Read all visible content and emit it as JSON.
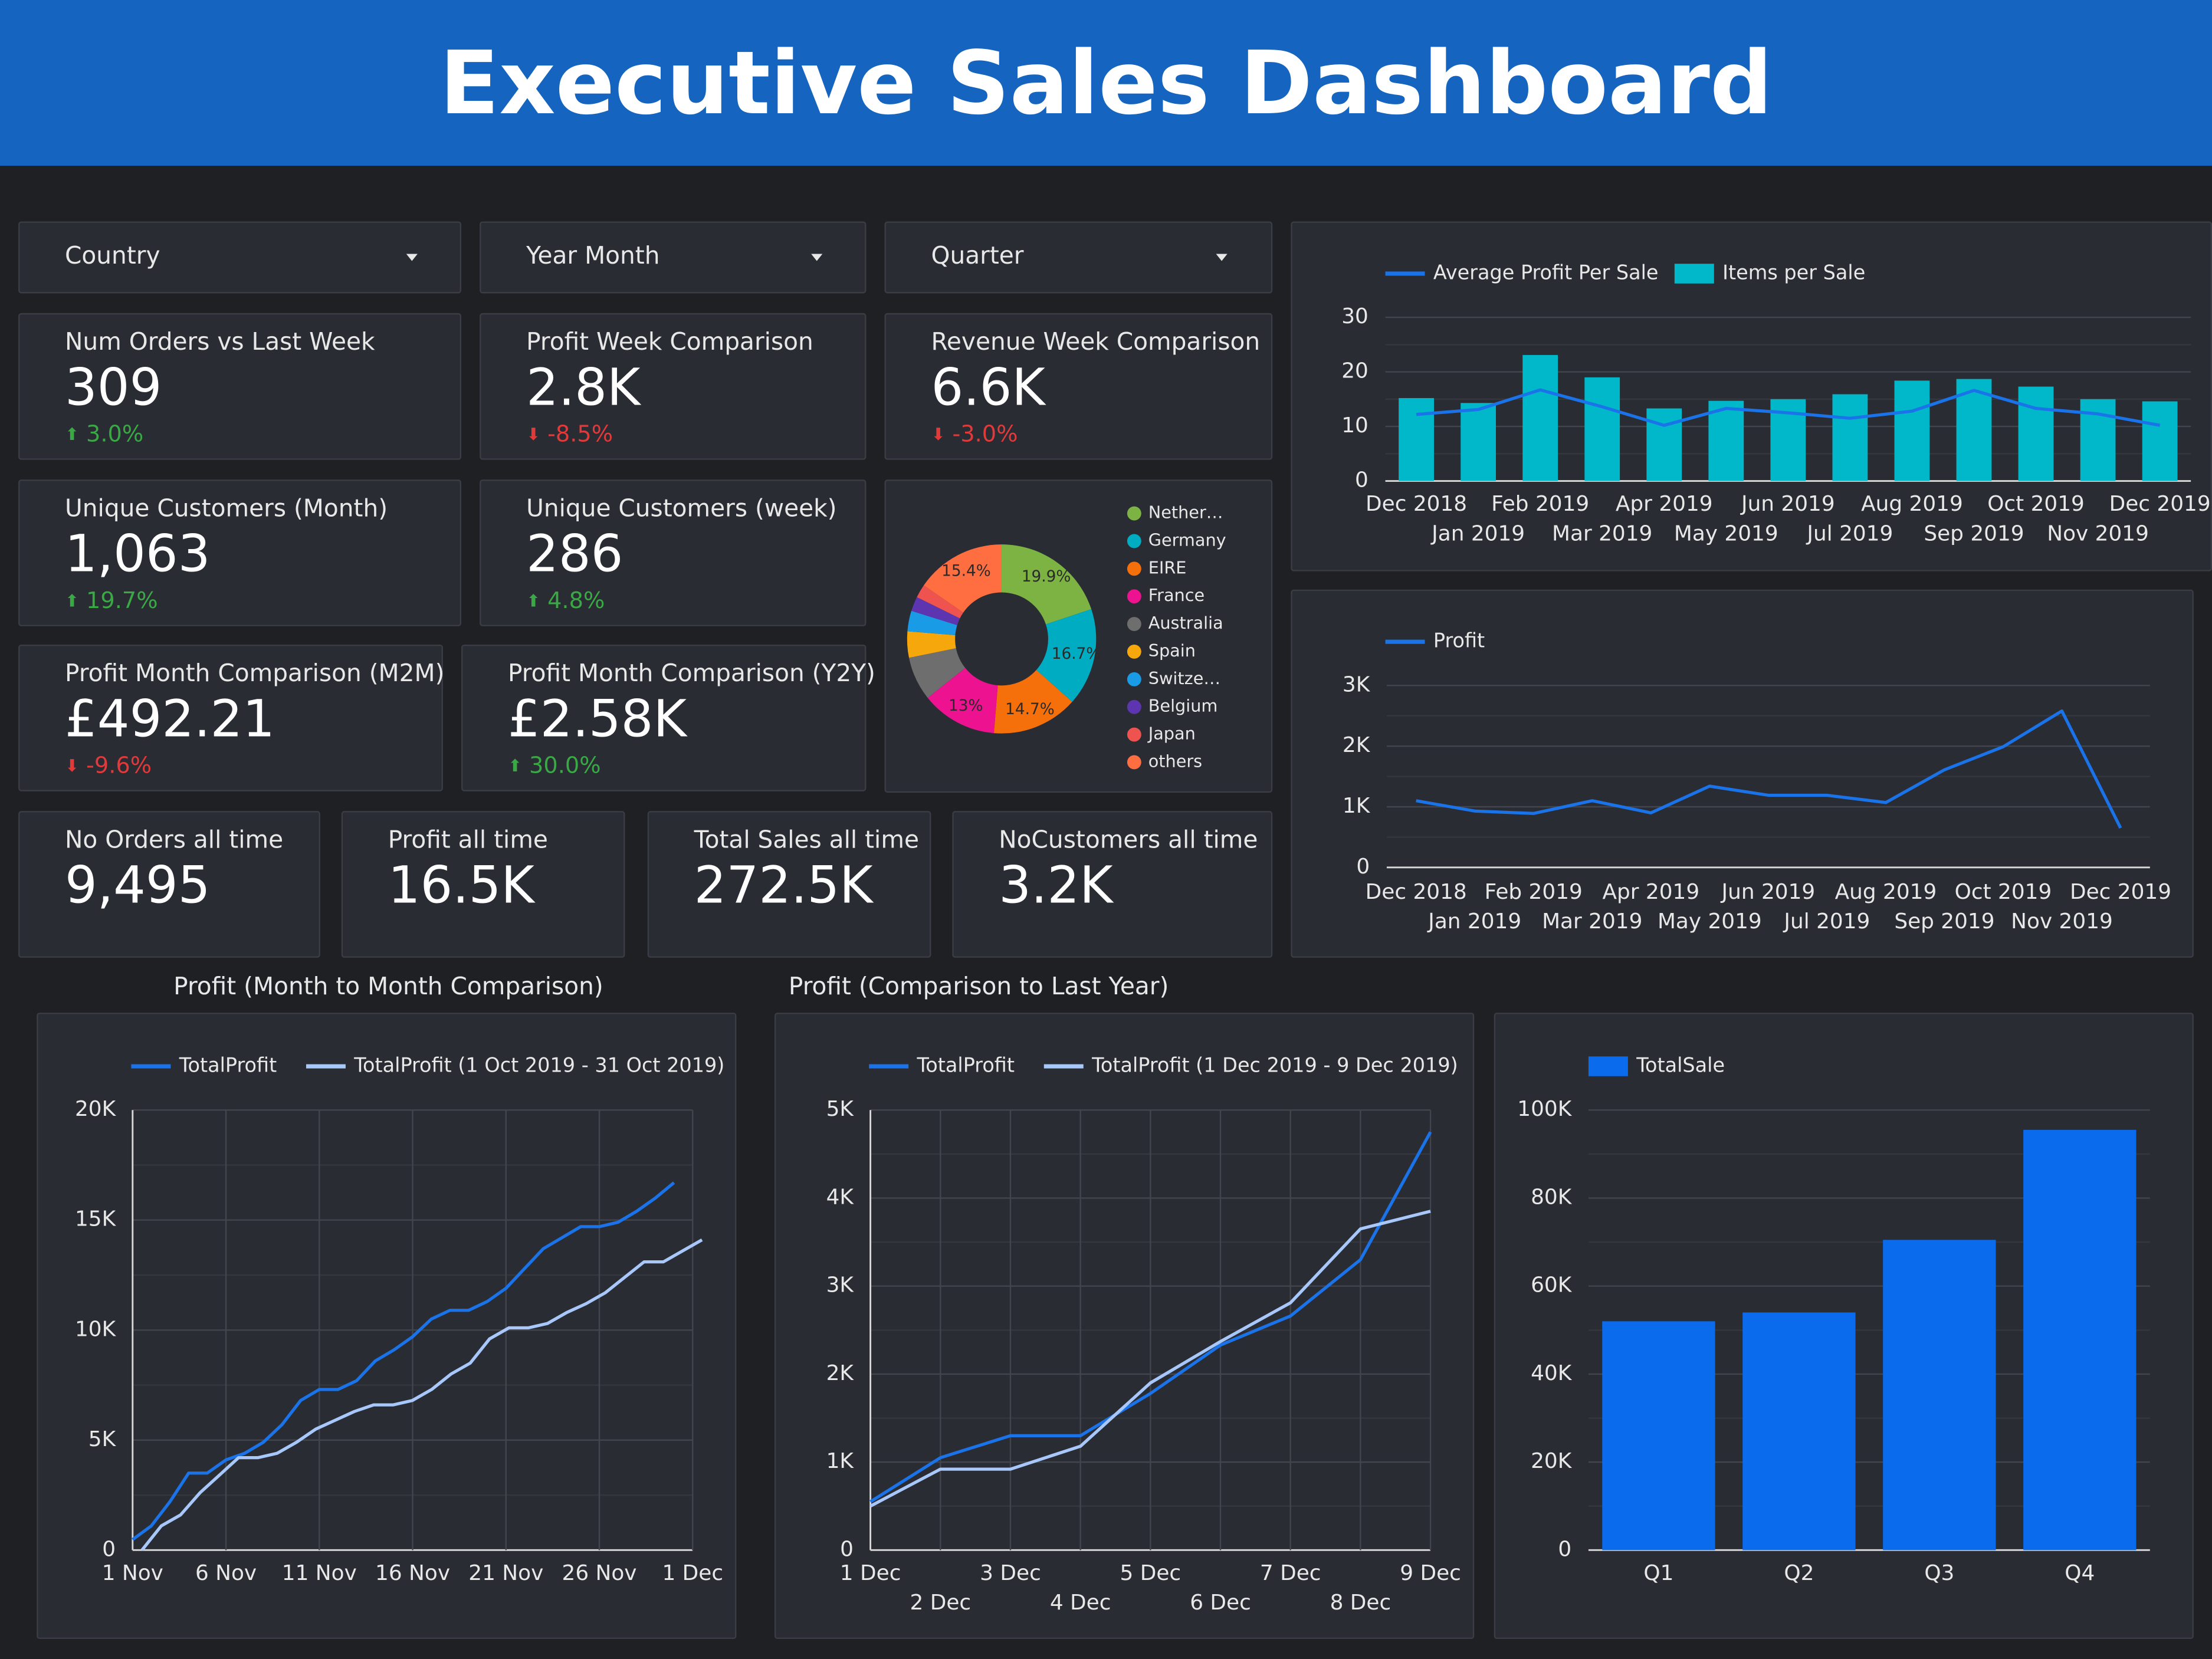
{
  "header": {
    "title": "Executive Sales Dashboard",
    "color": "#1565c0"
  },
  "filters": [
    {
      "label": "Country"
    },
    {
      "label": "Year Month"
    },
    {
      "label": "Quarter"
    }
  ],
  "kpis": {
    "orders_week": {
      "label": "Num Orders vs Last Week",
      "value": "309",
      "delta": "3.0%",
      "direction": "up"
    },
    "profit_week": {
      "label": "Profit Week Comparison",
      "value": "2.8K",
      "delta": "-8.5%",
      "direction": "down"
    },
    "revenue_week": {
      "label": "Revenue Week Comparison",
      "value": "6.6K",
      "delta": "-3.0%",
      "direction": "down"
    },
    "customers_month": {
      "label": "Unique Customers (Month)",
      "value": "1,063",
      "delta": "19.7%",
      "direction": "up"
    },
    "customers_week": {
      "label": "Unique Customers (week)",
      "value": "286",
      "delta": "4.8%",
      "direction": "up"
    },
    "profit_m2m": {
      "label": "Profit Month Comparison (M2M)",
      "value": "£492.21",
      "delta": "-9.6%",
      "direction": "down"
    },
    "profit_y2y": {
      "label": "Profit Month Comparison (Y2Y)",
      "value": "£2.58K",
      "delta": "30.0%",
      "direction": "up"
    },
    "orders_all": {
      "label": "No Orders all time",
      "value": "9,495"
    },
    "profit_all": {
      "label": "Profit all time",
      "value": "16.5K"
    },
    "sales_all": {
      "label": "Total Sales all time",
      "value": "272.5K"
    },
    "customers_all": {
      "label": "NoCustomers all time",
      "value": "3.2K"
    }
  },
  "colors": {
    "blue": "#1a73e8",
    "light_blue": "#a8c7fa",
    "teal": "#00b8c9",
    "bar_blue": "#0a6cec",
    "up": "#3aa845",
    "down": "#e03a3a"
  },
  "chart_data": [
    {
      "id": "country_donut",
      "type": "pie",
      "donut": true,
      "legend_position": "right",
      "legend": [
        "Nether…",
        "Germany",
        "EIRE",
        "France",
        "Australia",
        "Spain",
        "Switze…",
        "Belgium",
        "Japan",
        "others"
      ],
      "values": [
        19.9,
        16.7,
        14.7,
        13.0,
        7.5,
        4.5,
        3.5,
        2.5,
        2.3,
        15.4
      ],
      "colors": [
        "#7cb342",
        "#00acc1",
        "#f5700a",
        "#ec1290",
        "#6e6e6e",
        "#f6a70c",
        "#1a9be6",
        "#5e35b1",
        "#ef5350",
        "#ff6e40"
      ],
      "slice_labels": [
        "19.9%",
        "16.7%",
        "14.7%",
        "13%",
        "",
        "",
        "",
        "",
        "",
        "15.4%"
      ]
    },
    {
      "id": "combo_monthly",
      "type": "bar",
      "legend_position": "top-left",
      "categories": [
        "Dec 2018",
        "Jan 2019",
        "Feb 2019",
        "Mar 2019",
        "Apr 2019",
        "May 2019",
        "Jun 2019",
        "Jul 2019",
        "Aug 2019",
        "Sep 2019",
        "Oct 2019",
        "Nov 2019",
        "Dec 2019"
      ],
      "series": [
        {
          "name": "Items per Sale",
          "kind": "bar",
          "values": [
            15.2,
            14.3,
            23.1,
            19.0,
            13.3,
            14.7,
            15.0,
            15.9,
            18.4,
            18.7,
            17.3,
            15.0,
            14.6
          ]
        },
        {
          "name": "Average Profit Per Sale",
          "kind": "line",
          "values": [
            12.2,
            13.1,
            16.7,
            13.6,
            10.2,
            13.3,
            12.5,
            11.5,
            12.8,
            16.6,
            13.3,
            12.3,
            10.2
          ]
        }
      ],
      "ylim": [
        0,
        30
      ],
      "yticks": [
        "0",
        "10",
        "20",
        "30"
      ],
      "grid": true
    },
    {
      "id": "profit_monthly",
      "type": "line",
      "legend_position": "top-left",
      "categories": [
        "Dec 2018",
        "Jan 2019",
        "Feb 2019",
        "Mar 2019",
        "Apr 2019",
        "May 2019",
        "Jun 2019",
        "Jul 2019",
        "Aug 2019",
        "Sep 2019",
        "Oct 2019",
        "Nov 2019",
        "Dec 2019"
      ],
      "series": [
        {
          "name": "Profit",
          "values": [
            1100,
            930,
            890,
            1100,
            900,
            1340,
            1190,
            1190,
            1070,
            1610,
            1990,
            2580,
            650
          ]
        }
      ],
      "ylim": [
        0,
        3000
      ],
      "yticks": [
        "0",
        "1K",
        "2K",
        "3K"
      ],
      "grid": true
    },
    {
      "id": "profit_m2m_chart",
      "type": "line",
      "title": "Profit (Month to Month Comparison)",
      "legend_position": "top-left",
      "x_ticks": [
        "1 Nov",
        "6 Nov",
        "11 Nov",
        "16 Nov",
        "21 Nov",
        "26 Nov",
        "1 Dec"
      ],
      "series": [
        {
          "name": "TotalProfit",
          "values": [
            480,
            1100,
            2200,
            3500,
            3500,
            4100,
            4400,
            4900,
            5700,
            6800,
            7300,
            7300,
            7700,
            8600,
            9100,
            9700,
            10500,
            10900,
            10900,
            11300,
            11900,
            12800,
            13700,
            14200,
            14700,
            14700,
            14900,
            15400,
            16000,
            16700
          ]
        },
        {
          "name": "TotalProfit (1 Oct 2019 - 31 Oct 2019)",
          "values": [
            0,
            1100,
            1600,
            2600,
            3400,
            4200,
            4200,
            4400,
            4900,
            5500,
            5900,
            6300,
            6600,
            6600,
            6800,
            7300,
            8000,
            8500,
            9600,
            10100,
            10100,
            10300,
            10800,
            11200,
            11700,
            12400,
            13100,
            13100,
            13600,
            14100
          ]
        }
      ],
      "ylim": [
        0,
        20000
      ],
      "yticks": [
        "0",
        "5K",
        "10K",
        "15K",
        "20K"
      ],
      "grid": true
    },
    {
      "id": "profit_y2y_chart",
      "type": "line",
      "title": "Profit (Comparison to Last Year)",
      "legend_position": "top-left",
      "x_ticks": [
        "1 Dec",
        "2 Dec",
        "3 Dec",
        "4 Dec",
        "5 Dec",
        "6 Dec",
        "7 Dec",
        "8 Dec",
        "9 Dec"
      ],
      "series": [
        {
          "name": "TotalProfit",
          "values": [
            550,
            1050,
            1300,
            1300,
            1780,
            2330,
            2660,
            3300,
            4750
          ]
        },
        {
          "name": "TotalProfit (1 Dec 2019 - 9 Dec 2019)",
          "values": [
            500,
            920,
            920,
            1180,
            1900,
            2370,
            2810,
            3650,
            3850
          ]
        }
      ],
      "ylim": [
        0,
        5000
      ],
      "yticks": [
        "0",
        "1K",
        "2K",
        "3K",
        "4K",
        "5K"
      ],
      "grid": true
    },
    {
      "id": "sales_quarter",
      "type": "bar",
      "legend_position": "top-left",
      "categories": [
        "Q1",
        "Q2",
        "Q3",
        "Q4"
      ],
      "series": [
        {
          "name": "TotalSale",
          "values": [
            52000,
            54000,
            70500,
            95500
          ]
        }
      ],
      "ylim": [
        0,
        100000
      ],
      "yticks": [
        "0",
        "20K",
        "40K",
        "60K",
        "80K",
        "100K"
      ],
      "grid": true
    }
  ]
}
